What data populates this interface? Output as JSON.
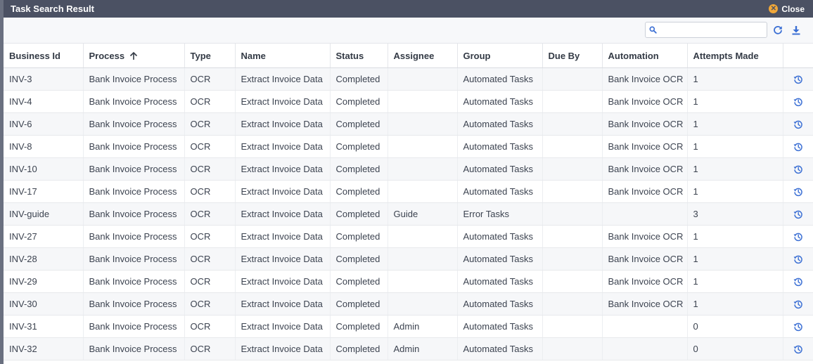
{
  "dialog": {
    "title": "Task Search Result",
    "close_label": "Close",
    "close_icon": "close-circle-icon"
  },
  "toolbar": {
    "search": {
      "placeholder": "",
      "value": "",
      "icon": "search-icon"
    },
    "refresh_icon": "refresh-icon",
    "download_icon": "download-icon"
  },
  "table": {
    "columns": [
      "Business Id",
      "Process",
      "Type",
      "Name",
      "Status",
      "Assignee",
      "Group",
      "Due By",
      "Automation",
      "Attempts Made"
    ],
    "sorted_column": "Process",
    "sort_direction": "ascending",
    "row_action_icon": "history-icon",
    "rows": [
      [
        "INV-3",
        "Bank Invoice Process",
        "OCR",
        "Extract Invoice Data",
        "Completed",
        "",
        "Automated Tasks",
        "",
        "Bank Invoice OCR",
        "1"
      ],
      [
        "INV-4",
        "Bank Invoice Process",
        "OCR",
        "Extract Invoice Data",
        "Completed",
        "",
        "Automated Tasks",
        "",
        "Bank Invoice OCR",
        "1"
      ],
      [
        "INV-6",
        "Bank Invoice Process",
        "OCR",
        "Extract Invoice Data",
        "Completed",
        "",
        "Automated Tasks",
        "",
        "Bank Invoice OCR",
        "1"
      ],
      [
        "INV-8",
        "Bank Invoice Process",
        "OCR",
        "Extract Invoice Data",
        "Completed",
        "",
        "Automated Tasks",
        "",
        "Bank Invoice OCR",
        "1"
      ],
      [
        "INV-10",
        "Bank Invoice Process",
        "OCR",
        "Extract Invoice Data",
        "Completed",
        "",
        "Automated Tasks",
        "",
        "Bank Invoice OCR",
        "1"
      ],
      [
        "INV-17",
        "Bank Invoice Process",
        "OCR",
        "Extract Invoice Data",
        "Completed",
        "",
        "Automated Tasks",
        "",
        "Bank Invoice OCR",
        "1"
      ],
      [
        "INV-guide",
        "Bank Invoice Process",
        "OCR",
        "Extract Invoice Data",
        "Completed",
        "Guide",
        "Error Tasks",
        "",
        "",
        "3"
      ],
      [
        "INV-27",
        "Bank Invoice Process",
        "OCR",
        "Extract Invoice Data",
        "Completed",
        "",
        "Automated Tasks",
        "",
        "Bank Invoice OCR",
        "1"
      ],
      [
        "INV-28",
        "Bank Invoice Process",
        "OCR",
        "Extract Invoice Data",
        "Completed",
        "",
        "Automated Tasks",
        "",
        "Bank Invoice OCR",
        "1"
      ],
      [
        "INV-29",
        "Bank Invoice Process",
        "OCR",
        "Extract Invoice Data",
        "Completed",
        "",
        "Automated Tasks",
        "",
        "Bank Invoice OCR",
        "1"
      ],
      [
        "INV-30",
        "Bank Invoice Process",
        "OCR",
        "Extract Invoice Data",
        "Completed",
        "",
        "Automated Tasks",
        "",
        "Bank Invoice OCR",
        "1"
      ],
      [
        "INV-31",
        "Bank Invoice Process",
        "OCR",
        "Extract Invoice Data",
        "Completed",
        "Admin",
        "Automated Tasks",
        "",
        "",
        "0"
      ],
      [
        "INV-32",
        "Bank Invoice Process",
        "OCR",
        "Extract Invoice Data",
        "Completed",
        "Admin",
        "Automated Tasks",
        "",
        "",
        "0"
      ]
    ]
  },
  "colors": {
    "titlebar_bg": "#4b5163",
    "close_icon": "#f2a838",
    "accent_icon": "#3b6fd4",
    "row_alt_bg": "#f6f7f9"
  }
}
